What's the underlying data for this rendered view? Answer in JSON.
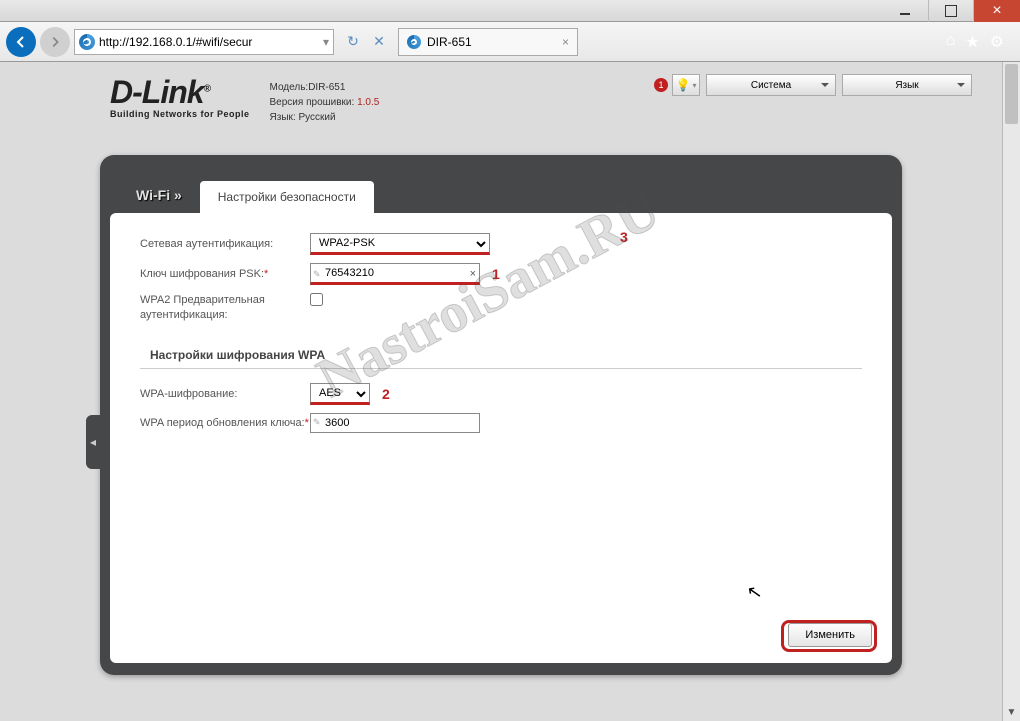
{
  "browser": {
    "url": "http://192.168.0.1/#wifi/secur",
    "tab_title": "DIR-651"
  },
  "header": {
    "logo_main": "D-Link",
    "logo_sub": "Building Networks for People",
    "model_label": "Модель:",
    "model_value": "DIR-651",
    "fw_label": "Версия прошивки:",
    "fw_value": "1.0.5",
    "lang_label": "Язык:",
    "lang_value": "Русский",
    "notif_count": "1",
    "dd_system": "Система",
    "dd_lang": "Язык"
  },
  "crumb": {
    "root": "Wi-Fi »",
    "tab": "Настройки безопасности"
  },
  "form": {
    "auth_label": "Сетевая аутентификация:",
    "auth_value": "WPA2-PSK",
    "psk_label": "Ключ шифрования PSK:",
    "psk_value": "76543210",
    "preauth_label": "WPA2 Предварительная аутентификация:",
    "section_wpa": "Настройки шифрования WPA",
    "enc_label": "WPA-шифрование:",
    "enc_value": "AES",
    "renew_label": "WPA период обновления ключа:",
    "renew_value": "3600",
    "submit": "Изменить"
  },
  "annotations": {
    "a1": "1",
    "a2": "2",
    "a3": "3"
  },
  "watermark": "NastroiSam.RU"
}
